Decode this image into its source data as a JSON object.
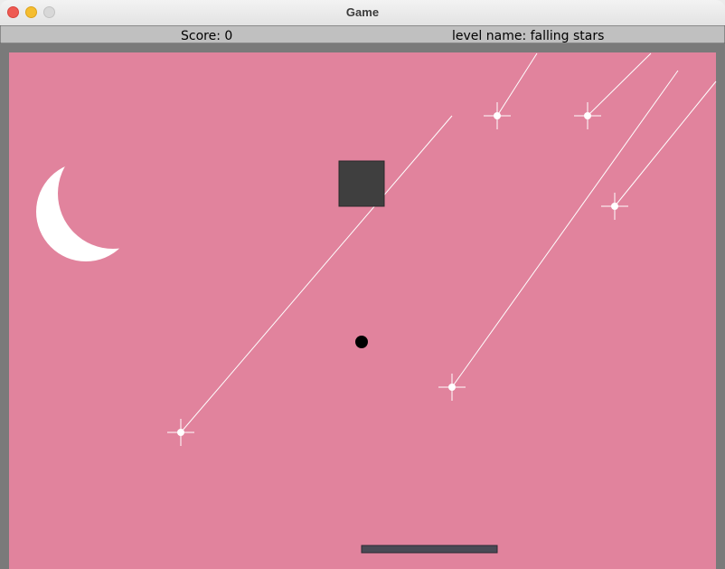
{
  "window": {
    "title": "Game"
  },
  "hud": {
    "score_label": "Score: 0",
    "level_label": "level name: falling stars"
  },
  "colors": {
    "hud_background": "#c0c0c0",
    "frame_border": "#7a7a7a",
    "sky": "#e1839d",
    "moon": "#ffffff",
    "star": "#ffffff",
    "block": "#3f3f3f",
    "ball": "#000000",
    "paddle": "#4a4a55"
  },
  "icons": {
    "moon": "crescent-moon-icon",
    "star": "sparkle-star-icon"
  }
}
